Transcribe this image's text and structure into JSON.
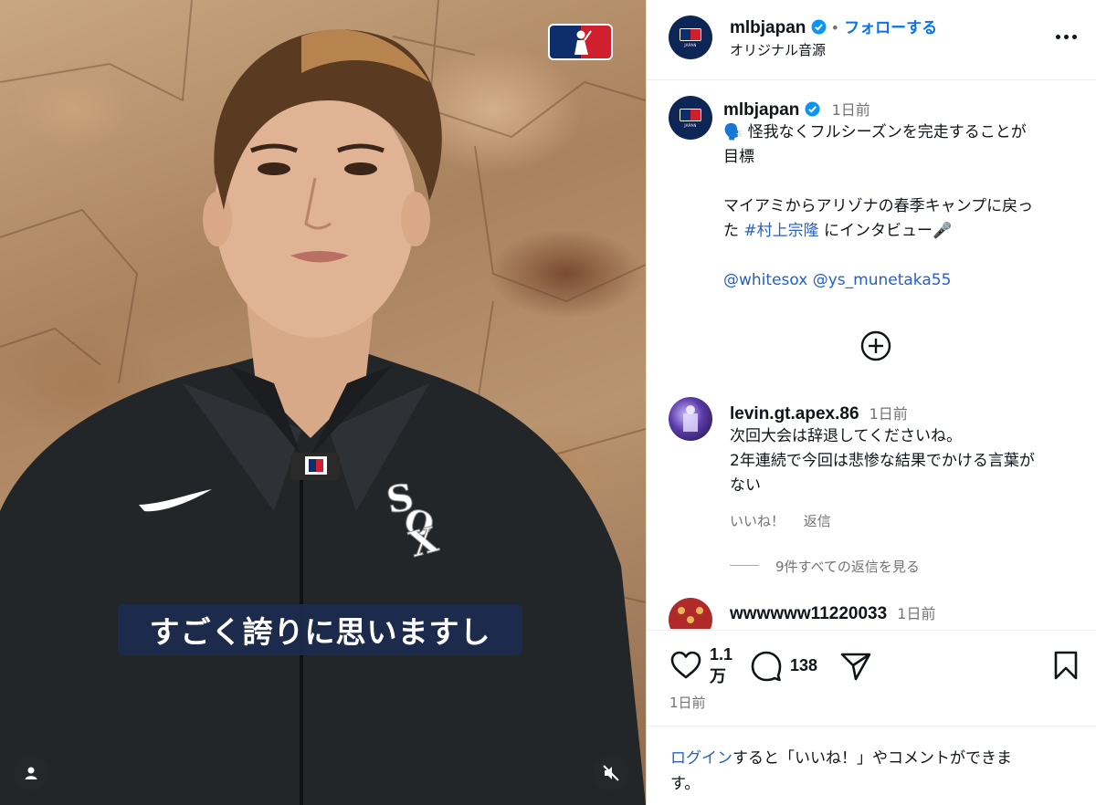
{
  "video": {
    "caption": "すごく誇りに思いますし"
  },
  "post": {
    "username": "mlbjapan",
    "follow_label": "フォローする",
    "dot": "•",
    "audio_label": "オリジナル音源",
    "avatar_text": "JAPAN"
  },
  "caption": {
    "username": "mlbjapan",
    "time": "1日前",
    "line1": "🗣️ 怪我なくフルシーズンを完走することが",
    "line2": "目標",
    "line3": "マイアミからアリゾナの春季キャンプに戻っ",
    "line4_prefix": "た ",
    "hashtag": "#村上宗隆",
    "line4_suffix": " にインタビュー🎤",
    "mention1": "@whitesox",
    "mention2": "@ys_munetaka55"
  },
  "comments": [
    {
      "username": "levin.gt.apex.86",
      "time": "1日前",
      "line1": "次回大会は辞退してくださいね。",
      "line2": "2年連続で今回は悲惨な結果でかける言葉が",
      "line3": "ない",
      "like_label": "いいね！",
      "reply_label": "返信",
      "view_replies": "9件すべての返信を見る"
    },
    {
      "username": "wwwwww11220033",
      "time": "1日前"
    }
  ],
  "actions": {
    "likes_line1": "1.1",
    "likes_line2": "万",
    "comments_count": "138",
    "date": "1日前"
  },
  "login": {
    "link": "ログイン",
    "text_line1": "すると「いいね！」やコメントができま",
    "text_line2": "す。"
  },
  "colors": {
    "accent": "#0a73ec",
    "link": "#2560c5",
    "mlb_blue": "#0d2656",
    "mlb_red": "#d0202e"
  }
}
